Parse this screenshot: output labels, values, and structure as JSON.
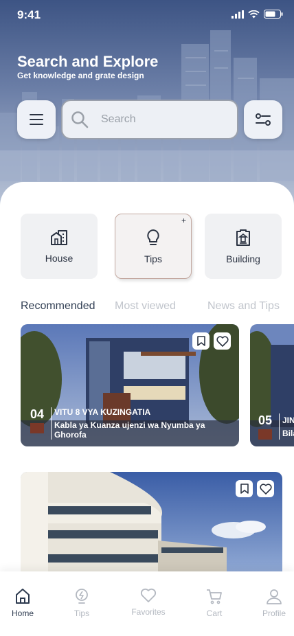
{
  "status": {
    "time": "9:41"
  },
  "header": {
    "title": "Search and Explore",
    "subtitle": "Get knowledge and grate design"
  },
  "search": {
    "placeholder": "Search"
  },
  "categories": [
    {
      "label": "House",
      "icon": "house-icon"
    },
    {
      "label": "Tips",
      "icon": "lightbulb-icon",
      "badge": "+"
    },
    {
      "label": "Building",
      "icon": "building-icon"
    }
  ],
  "tabs": [
    {
      "label": "Recommended",
      "active": true
    },
    {
      "label": "Most viewed",
      "active": false
    },
    {
      "label": "News and Tips",
      "active": false
    }
  ],
  "cards": [
    {
      "number": "04",
      "title": "VITU 8 VYA KUZINGATIA",
      "subtitle": "Kabla ya Kuanza ujenzi wa Nyumba ya Ghorofa"
    },
    {
      "number": "05",
      "title": "JIN",
      "subtitle": "Bila"
    }
  ],
  "nav": [
    {
      "label": "Home",
      "icon": "home-icon",
      "active": true
    },
    {
      "label": "Tips",
      "icon": "lightbulb-icon",
      "active": false
    },
    {
      "label": "Favorites",
      "icon": "heart-icon",
      "active": false
    },
    {
      "label": "Cart",
      "icon": "cart-icon",
      "active": false
    },
    {
      "label": "Profile",
      "icon": "profile-icon",
      "active": false
    }
  ],
  "colors": {
    "primary": "#2f3d52",
    "header": "#3d5484",
    "inactive": "#c1c5cc"
  }
}
